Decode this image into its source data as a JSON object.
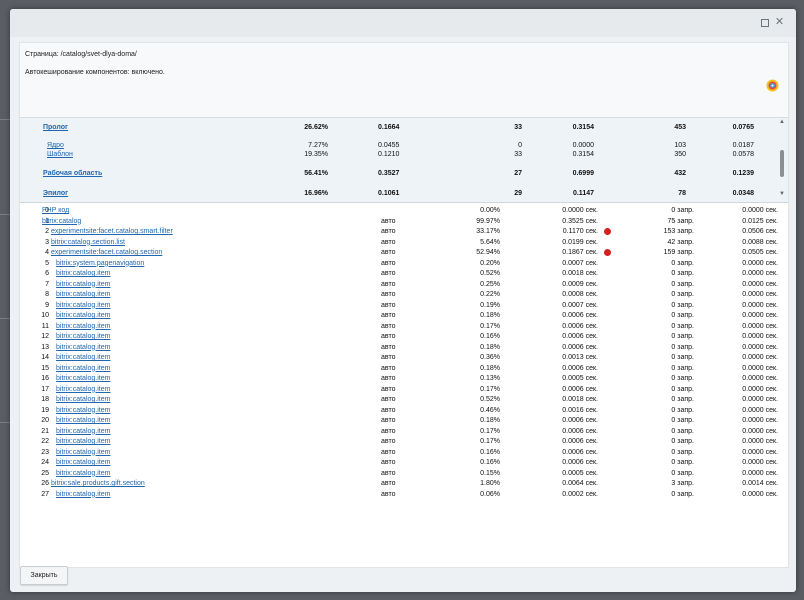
{
  "window": {
    "maximize_icon": "maximize-icon",
    "close_icon": "close-icon",
    "close_glyph": "✕"
  },
  "info": {
    "page_line": "Страница: /catalog/svet-dlya-doma/",
    "cache_line": "Автокеширование компонентов: включено."
  },
  "summary_rows": [
    {
      "name": "Пролог",
      "pct": "26.62%",
      "time": "0.1664",
      "queries": "33",
      "qtime": "0.3154",
      "count": "453",
      "ctime": "0.0765",
      "bold": true,
      "indent": false
    },
    {
      "name": "Ядро",
      "pct": "7.27%",
      "time": "0.0455",
      "queries": "0",
      "qtime": "0.0000",
      "count": "103",
      "ctime": "0.0187",
      "bold": false,
      "indent": true
    },
    {
      "name": "Шаблон",
      "pct": "19.35%",
      "time": "0.1210",
      "queries": "33",
      "qtime": "0.3154",
      "count": "350",
      "ctime": "0.0578",
      "bold": false,
      "indent": true
    },
    {
      "name": "Рабочая область",
      "pct": "56.41%",
      "time": "0.3527",
      "queries": "27",
      "qtime": "0.6999",
      "count": "432",
      "ctime": "0.1239",
      "bold": true,
      "indent": false
    },
    {
      "name": "Эпилог",
      "pct": "16.96%",
      "time": "0.1061",
      "queries": "29",
      "qtime": "0.1147",
      "count": "78",
      "ctime": "0.0348",
      "bold": true,
      "indent": false
    }
  ],
  "detail_rows": [
    {
      "n": "0",
      "name": "PHP код",
      "cache": "",
      "pct": "0.00%",
      "time": "0.0000 сек.",
      "dot": false,
      "q": "0 запр.",
      "qt": "0.0000 сек.",
      "lvl": 0
    },
    {
      "n": "1",
      "name": "bitrix:catalog",
      "cache": "авто",
      "pct": "99.97%",
      "time": "0.3525 сек.",
      "dot": false,
      "q": "75 запр.",
      "qt": "0.0125 сек.",
      "lvl": 0
    },
    {
      "n": "2",
      "name": "experimentsite:facet.catalog.smart.filter",
      "cache": "авто",
      "pct": "33.17%",
      "time": "0.1170 сек.",
      "dot": true,
      "q": "153 запр.",
      "qt": "0.0506 сек.",
      "lvl": 1
    },
    {
      "n": "3",
      "name": "bitrix:catalog.section.list",
      "cache": "авто",
      "pct": "5.64%",
      "time": "0.0199 сек.",
      "dot": false,
      "q": "42 запр.",
      "qt": "0.0088 сек.",
      "lvl": 1
    },
    {
      "n": "4",
      "name": "experimentsite:facet.catalog.section",
      "cache": "авто",
      "pct": "52.94%",
      "time": "0.1867 сек.",
      "dot": true,
      "q": "159 запр.",
      "qt": "0.0505 сек.",
      "lvl": 1
    },
    {
      "n": "5",
      "name": "bitrix:system.pagenavigation",
      "cache": "авто",
      "pct": "0.20%",
      "time": "0.0007 сек.",
      "dot": false,
      "q": "0 запр.",
      "qt": "0.0000 сек.",
      "lvl": 2
    },
    {
      "n": "6",
      "name": "bitrix:catalog.item",
      "cache": "авто",
      "pct": "0.52%",
      "time": "0.0018 сек.",
      "dot": false,
      "q": "0 запр.",
      "qt": "0.0000 сек.",
      "lvl": 2
    },
    {
      "n": "7",
      "name": "bitrix:catalog.item",
      "cache": "авто",
      "pct": "0.25%",
      "time": "0.0009 сек.",
      "dot": false,
      "q": "0 запр.",
      "qt": "0.0000 сек.",
      "lvl": 2
    },
    {
      "n": "8",
      "name": "bitrix:catalog.item",
      "cache": "авто",
      "pct": "0.22%",
      "time": "0.0008 сек.",
      "dot": false,
      "q": "0 запр.",
      "qt": "0.0000 сек.",
      "lvl": 2
    },
    {
      "n": "9",
      "name": "bitrix:catalog.item",
      "cache": "авто",
      "pct": "0.19%",
      "time": "0.0007 сек.",
      "dot": false,
      "q": "0 запр.",
      "qt": "0.0000 сек.",
      "lvl": 2
    },
    {
      "n": "10",
      "name": "bitrix:catalog.item",
      "cache": "авто",
      "pct": "0.18%",
      "time": "0.0006 сек.",
      "dot": false,
      "q": "0 запр.",
      "qt": "0.0000 сек.",
      "lvl": 2
    },
    {
      "n": "11",
      "name": "bitrix:catalog.item",
      "cache": "авто",
      "pct": "0.17%",
      "time": "0.0006 сек.",
      "dot": false,
      "q": "0 запр.",
      "qt": "0.0000 сек.",
      "lvl": 2
    },
    {
      "n": "12",
      "name": "bitrix:catalog.item",
      "cache": "авто",
      "pct": "0.16%",
      "time": "0.0006 сек.",
      "dot": false,
      "q": "0 запр.",
      "qt": "0.0000 сек.",
      "lvl": 2
    },
    {
      "n": "13",
      "name": "bitrix:catalog.item",
      "cache": "авто",
      "pct": "0.18%",
      "time": "0.0006 сек.",
      "dot": false,
      "q": "0 запр.",
      "qt": "0.0000 сек.",
      "lvl": 2
    },
    {
      "n": "14",
      "name": "bitrix:catalog.item",
      "cache": "авто",
      "pct": "0.36%",
      "time": "0.0013 сек.",
      "dot": false,
      "q": "0 запр.",
      "qt": "0.0000 сек.",
      "lvl": 2
    },
    {
      "n": "15",
      "name": "bitrix:catalog.item",
      "cache": "авто",
      "pct": "0.18%",
      "time": "0.0006 сек.",
      "dot": false,
      "q": "0 запр.",
      "qt": "0.0000 сек.",
      "lvl": 2
    },
    {
      "n": "16",
      "name": "bitrix:catalog.item",
      "cache": "авто",
      "pct": "0.13%",
      "time": "0.0005 сек.",
      "dot": false,
      "q": "0 запр.",
      "qt": "0.0000 сек.",
      "lvl": 2
    },
    {
      "n": "17",
      "name": "bitrix:catalog.item",
      "cache": "авто",
      "pct": "0.17%",
      "time": "0.0006 сек.",
      "dot": false,
      "q": "0 запр.",
      "qt": "0.0000 сек.",
      "lvl": 2
    },
    {
      "n": "18",
      "name": "bitrix:catalog.item",
      "cache": "авто",
      "pct": "0.52%",
      "time": "0.0018 сек.",
      "dot": false,
      "q": "0 запр.",
      "qt": "0.0000 сек.",
      "lvl": 2
    },
    {
      "n": "19",
      "name": "bitrix:catalog.item",
      "cache": "авто",
      "pct": "0.46%",
      "time": "0.0016 сек.",
      "dot": false,
      "q": "0 запр.",
      "qt": "0.0000 сек.",
      "lvl": 2
    },
    {
      "n": "20",
      "name": "bitrix:catalog.item",
      "cache": "авто",
      "pct": "0.18%",
      "time": "0.0006 сек.",
      "dot": false,
      "q": "0 запр.",
      "qt": "0.0000 сек.",
      "lvl": 2
    },
    {
      "n": "21",
      "name": "bitrix:catalog.item",
      "cache": "авто",
      "pct": "0.17%",
      "time": "0.0006 сек.",
      "dot": false,
      "q": "0 запр.",
      "qt": "0.0000 сек.",
      "lvl": 2
    },
    {
      "n": "22",
      "name": "bitrix:catalog.item",
      "cache": "авто",
      "pct": "0.17%",
      "time": "0.0006 сек.",
      "dot": false,
      "q": "0 запр.",
      "qt": "0.0000 сек.",
      "lvl": 2
    },
    {
      "n": "23",
      "name": "bitrix:catalog.item",
      "cache": "авто",
      "pct": "0.16%",
      "time": "0.0006 сек.",
      "dot": false,
      "q": "0 запр.",
      "qt": "0.0000 сек.",
      "lvl": 2
    },
    {
      "n": "24",
      "name": "bitrix:catalog.item",
      "cache": "авто",
      "pct": "0.16%",
      "time": "0.0006 сек.",
      "dot": false,
      "q": "0 запр.",
      "qt": "0.0000 сек.",
      "lvl": 2
    },
    {
      "n": "25",
      "name": "bitrix:catalog.item",
      "cache": "авто",
      "pct": "0.15%",
      "time": "0.0005 сек.",
      "dot": false,
      "q": "0 запр.",
      "qt": "0.0000 сек.",
      "lvl": 2
    },
    {
      "n": "26",
      "name": "bitrix:sale.products.gift.section",
      "cache": "авто",
      "pct": "1.80%",
      "time": "0.0064 сек.",
      "dot": false,
      "q": "3 запр.",
      "qt": "0.0014 сек.",
      "lvl": 1
    },
    {
      "n": "27",
      "name": "bitrix:catalog.item",
      "cache": "авто",
      "pct": "0.06%",
      "time": "0.0002 сек.",
      "dot": false,
      "q": "0 запр.",
      "qt": "0.0000 сек.",
      "lvl": 2
    }
  ],
  "footer": {
    "close_label": "Закрыть"
  }
}
